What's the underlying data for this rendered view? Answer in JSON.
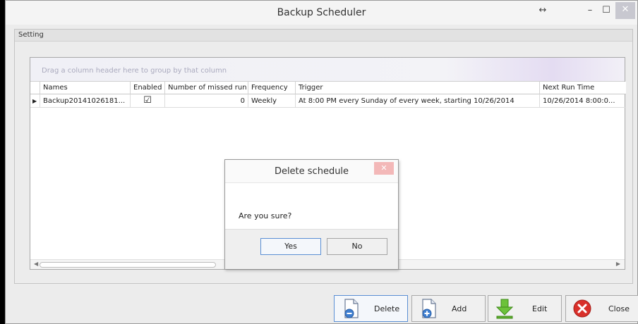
{
  "window": {
    "title": "Backup Scheduler",
    "resize_glyph": "↔",
    "min_glyph": "–",
    "max_glyph": "☐",
    "close_glyph": "✕"
  },
  "group": {
    "title": "Setting"
  },
  "grid": {
    "group_hint": "Drag a column header here to group by that column",
    "columns": [
      "Names",
      "Enabled",
      "Number of missed run",
      "Frequency",
      "Trigger",
      "Next Run Time"
    ],
    "rows": [
      {
        "indicator": "▶",
        "name": "Backup20141026181...",
        "enabled": "☑",
        "missed": "0",
        "frequency": "Weekly",
        "trigger": "At 8:00 PM every Sunday of every week, starting 10/26/2014",
        "next_run": "10/26/2014 8:00:0..."
      }
    ],
    "scroll_left": "◀",
    "scroll_right": "▶"
  },
  "dialog": {
    "title": "Delete schedule",
    "close_glyph": "✕",
    "message": "Are you sure?",
    "yes_label": "Yes",
    "no_label": "No"
  },
  "actions": {
    "delete_label": "Delete",
    "add_label": "Add",
    "edit_label": "Edit",
    "close_label": "Close"
  },
  "colors": {
    "accent_focus": "#5b8fd4",
    "close_red": "#d9302a",
    "edit_green": "#5fae2e"
  }
}
